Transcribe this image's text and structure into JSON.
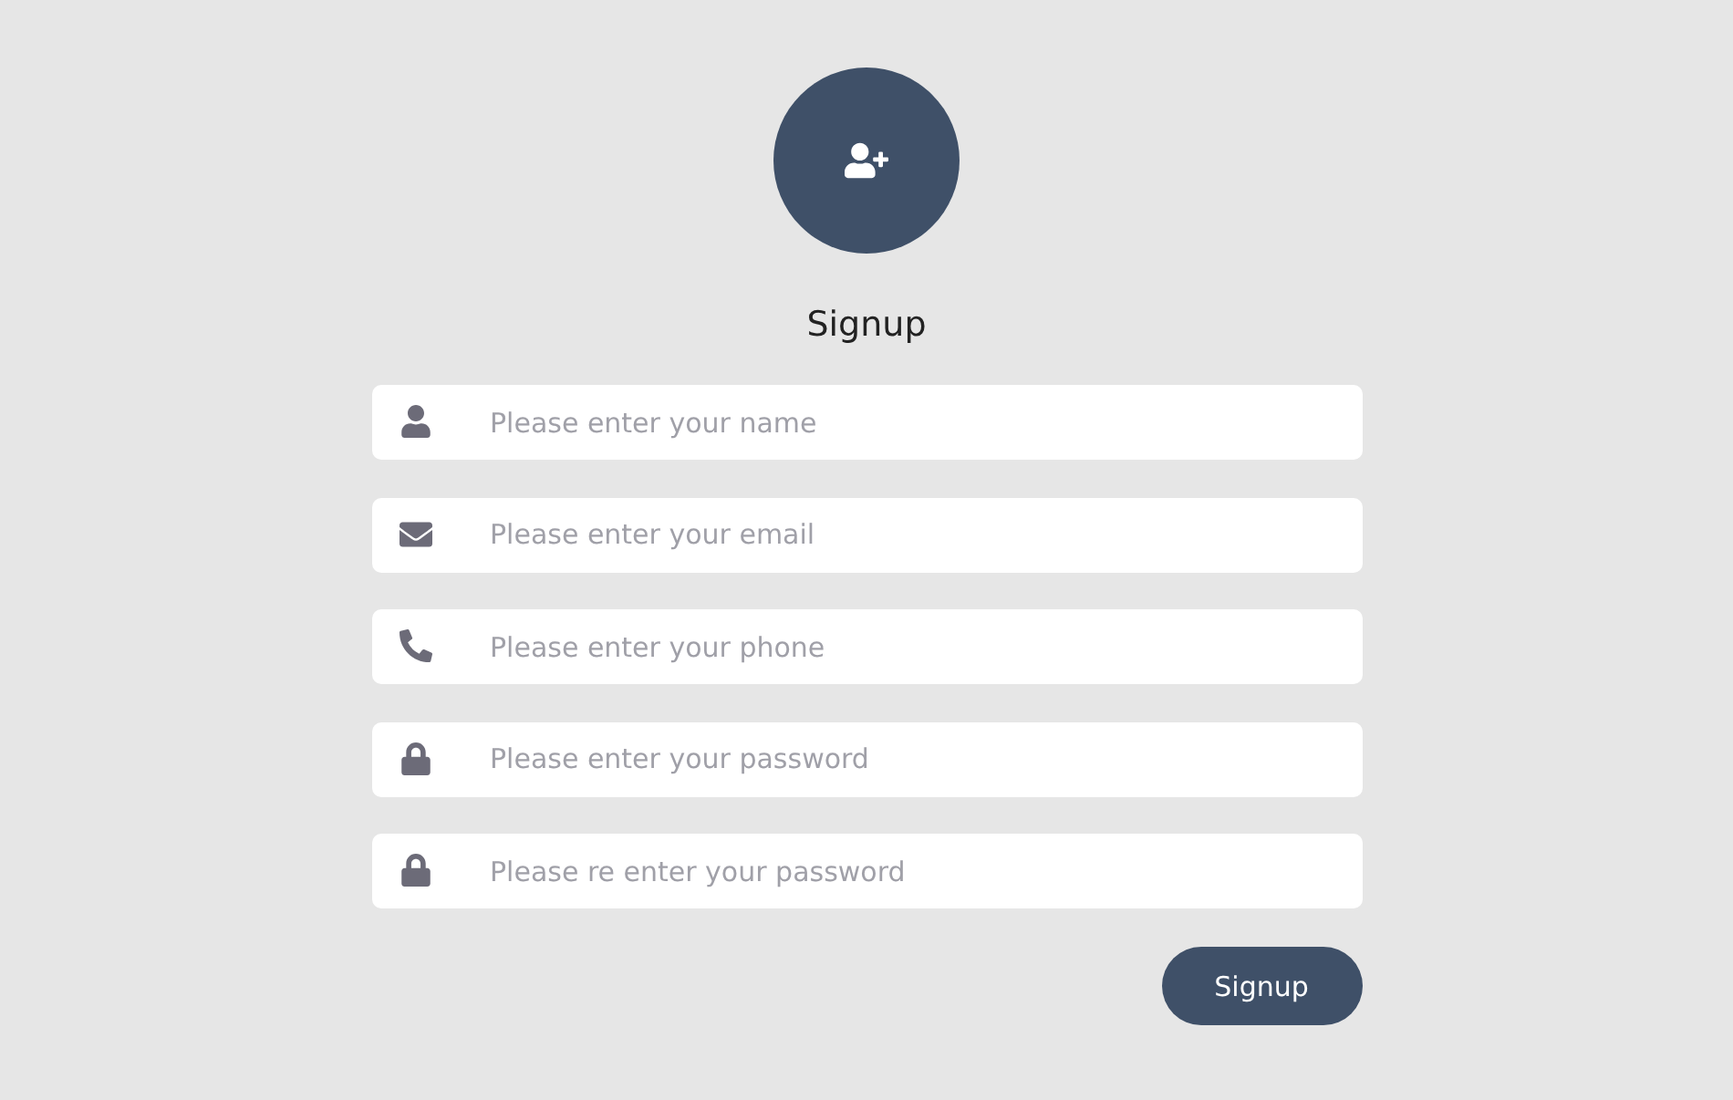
{
  "title": "Signup",
  "fields": [
    {
      "kind": "name",
      "placeholder": "Please enter your name"
    },
    {
      "kind": "email",
      "placeholder": "Please enter your email"
    },
    {
      "kind": "phone",
      "placeholder": "Please enter your phone"
    },
    {
      "kind": "password",
      "placeholder": "Please enter your password"
    },
    {
      "kind": "password",
      "placeholder": "Please re enter your password"
    }
  ],
  "submit": {
    "label": "Signup"
  }
}
